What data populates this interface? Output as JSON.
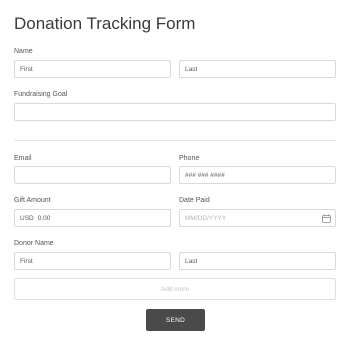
{
  "form": {
    "title": "Donation Tracking Form",
    "name": {
      "label": "Name",
      "first_placeholder": "First",
      "last_placeholder": "Last"
    },
    "fundraising_goal": {
      "label": "Fundraising Goal",
      "value": ""
    },
    "email": {
      "label": "Email",
      "value": ""
    },
    "phone": {
      "label": "Phone",
      "placeholder": "### ### ####"
    },
    "gift_amount": {
      "label": "Gift Amount",
      "currency": "USD",
      "value": "0.00"
    },
    "date_paid": {
      "label": "Date Paid",
      "placeholder": "MM/DD/YYYY",
      "icon": "calendar-icon"
    },
    "donor_name": {
      "label": "Donor Name",
      "first_placeholder": "First",
      "last_placeholder": "Last"
    },
    "add_more_label": "Add more",
    "send_label": "SEND"
  }
}
